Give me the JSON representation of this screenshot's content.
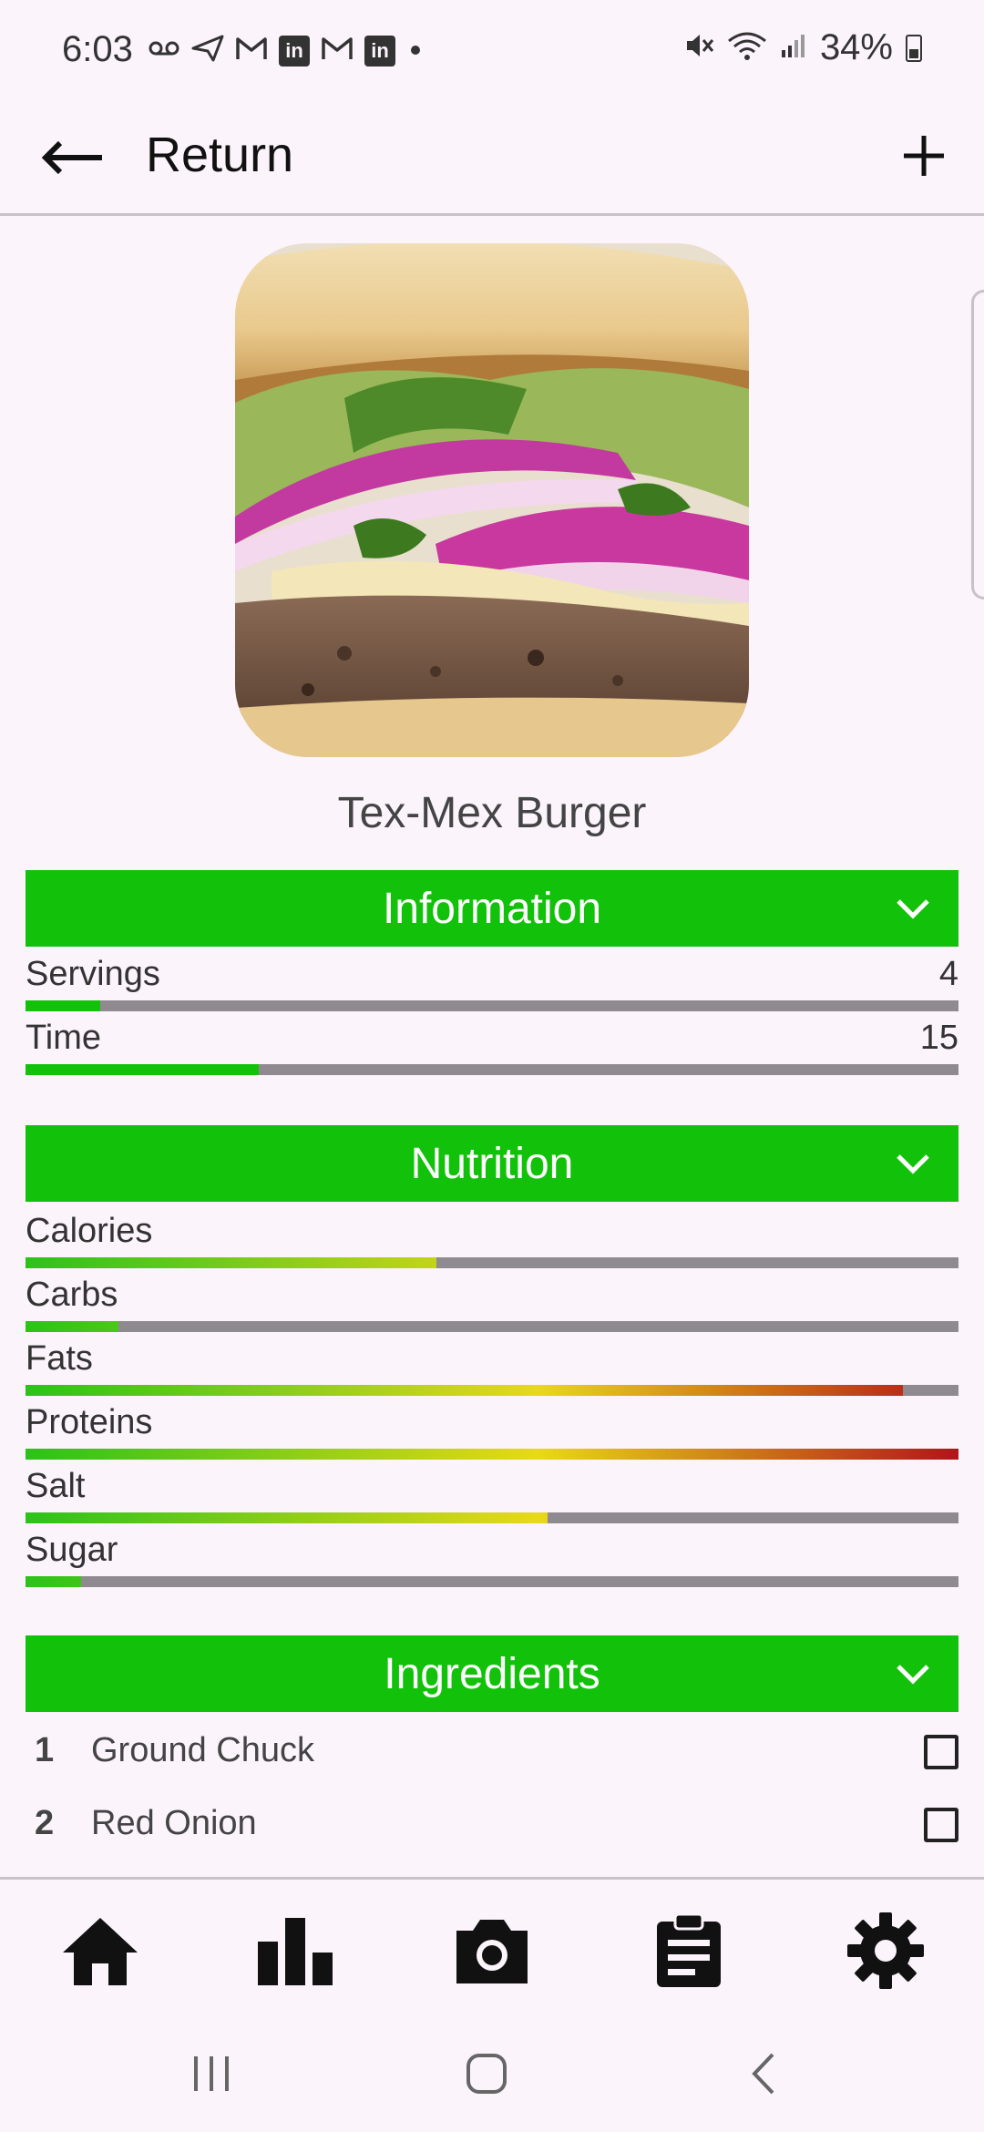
{
  "status_bar": {
    "time": "6:03",
    "battery": "34%",
    "left_icons": [
      "voicemail-icon",
      "send-icon",
      "gmail-icon",
      "linkedin-icon",
      "gmail-icon",
      "linkedin-icon",
      "dot-icon"
    ],
    "right_icons": [
      "mute-icon",
      "wifi-icon",
      "signal-icon",
      "battery-icon"
    ]
  },
  "app_bar": {
    "title": "Return",
    "back_icon": "arrow-left-icon",
    "add_icon": "plus-icon"
  },
  "recipe": {
    "title": "Tex-Mex Burger",
    "image": "burger-photo"
  },
  "sections": {
    "information": {
      "label": "Information",
      "rows": [
        {
          "label": "Servings",
          "value": "4",
          "fill": 0.08
        },
        {
          "label": "Time",
          "value": "15",
          "fill": 0.25
        }
      ]
    },
    "nutrition": {
      "label": "Nutrition",
      "rows": [
        {
          "label": "Calories",
          "fill": 0.44
        },
        {
          "label": "Carbs",
          "fill": 0.1
        },
        {
          "label": "Fats",
          "fill": 0.94
        },
        {
          "label": "Proteins",
          "fill": 1.0
        },
        {
          "label": "Salt",
          "fill": 0.56
        },
        {
          "label": "Sugar",
          "fill": 0.06
        }
      ]
    },
    "ingredients": {
      "label": "Ingredients",
      "items": [
        {
          "num": "1",
          "name": "Ground Chuck",
          "checked": false
        },
        {
          "num": "2",
          "name": "Red Onion",
          "checked": false
        }
      ]
    }
  },
  "colors": {
    "accent_green": "#12c20a",
    "track_gray": "#8f8a90",
    "gradient_green": "#2cc21a",
    "gradient_yellow": "#e8d81a",
    "gradient_red": "#b0151a",
    "background": "#fcf4fb"
  },
  "bottom_nav": [
    {
      "name": "home",
      "icon": "home-icon"
    },
    {
      "name": "stats",
      "icon": "bar-chart-icon"
    },
    {
      "name": "camera",
      "icon": "camera-icon"
    },
    {
      "name": "list",
      "icon": "clipboard-icon"
    },
    {
      "name": "settings",
      "icon": "gear-icon"
    }
  ],
  "system_nav": [
    "recent-apps-icon",
    "home-circle-icon",
    "back-chevron-icon"
  ]
}
